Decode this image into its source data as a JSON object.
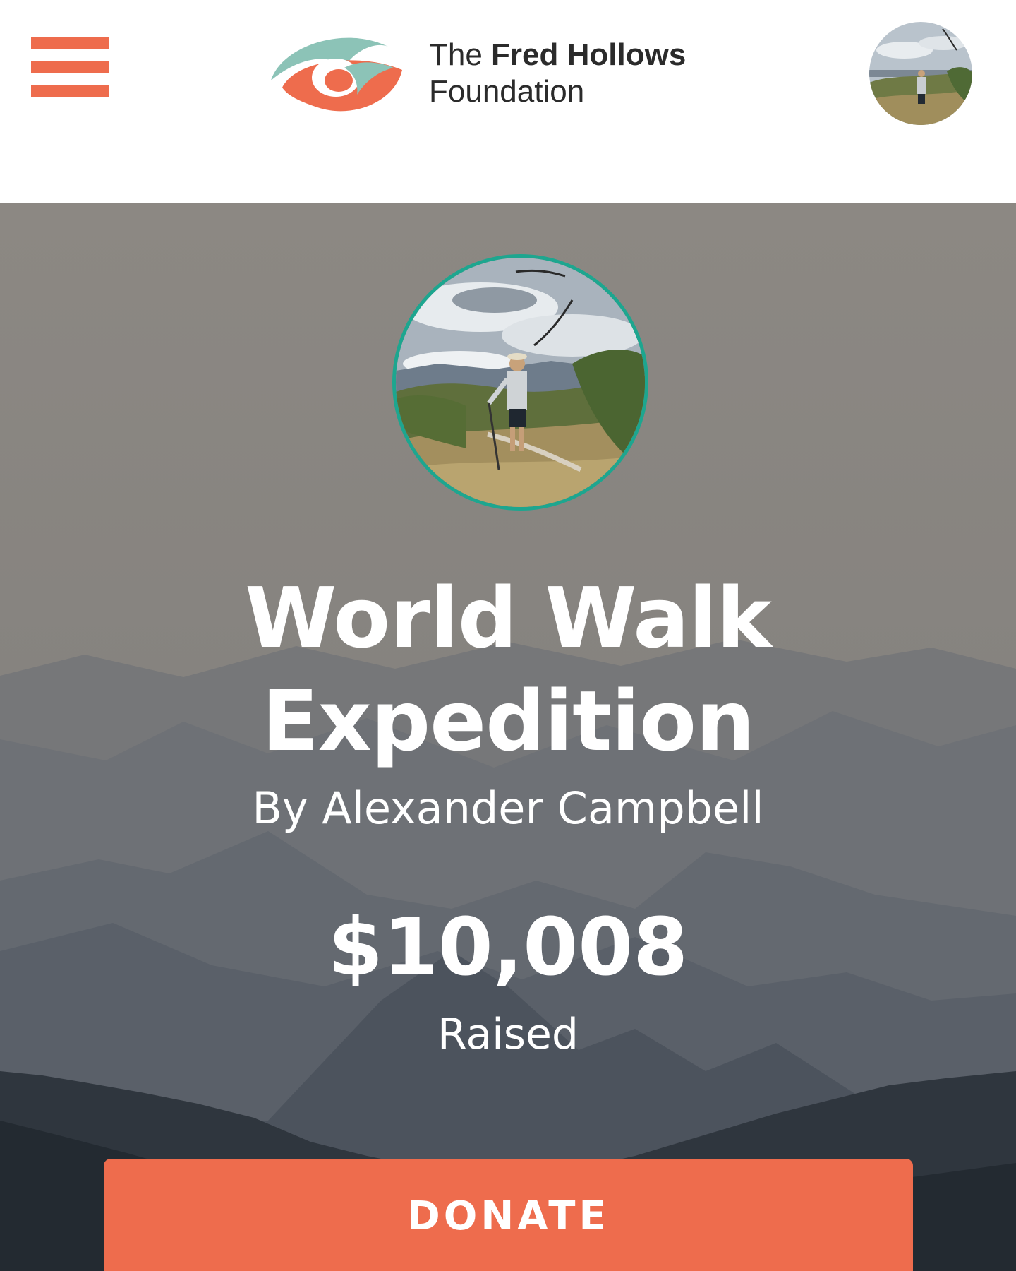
{
  "header": {
    "menu_icon": "hamburger-menu-icon",
    "logo_icon": "fred-hollows-eye-logo",
    "brand_line1_prefix": "The ",
    "brand_line1_bold": "Fred Hollows",
    "brand_line2": "Foundation",
    "avatar": "user-avatar-hiker-photo"
  },
  "campaign": {
    "profile_photo": "hiker-profile-photo",
    "title_line1": "World Walk",
    "title_line2": "Expedition",
    "byline": "By Alexander Campbell",
    "amount": "$10,008",
    "amount_label": "Raised",
    "donate_label": "DONATE",
    "background": "misty-mountain-range-photo"
  },
  "colors": {
    "accent": "#ee6c4d",
    "logo_teal": "#8cc3b7",
    "photo_ring": "#1da68f",
    "hero_sky": "#8f8b86"
  }
}
